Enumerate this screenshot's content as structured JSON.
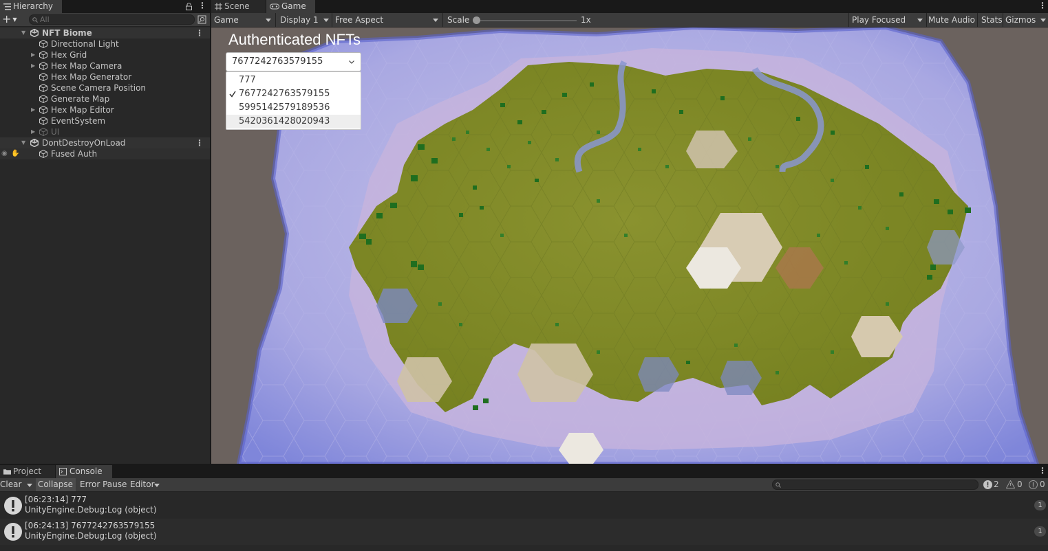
{
  "hierarchy": {
    "tab_label": "Hierarchy",
    "search_placeholder": "All",
    "items": [
      {
        "label": "NFT Biome",
        "type": "scene"
      },
      {
        "label": "Directional Light",
        "type": "object"
      },
      {
        "label": "Hex Grid",
        "type": "object",
        "expandable": true
      },
      {
        "label": "Hex Map Camera",
        "type": "object",
        "expandable": true
      },
      {
        "label": "Hex Map Generator",
        "type": "object"
      },
      {
        "label": "Scene Camera Position",
        "type": "object"
      },
      {
        "label": "Generate Map",
        "type": "object"
      },
      {
        "label": "Hex Map Editor",
        "type": "object",
        "expandable": true
      },
      {
        "label": "EventSystem",
        "type": "object"
      },
      {
        "label": "UI",
        "type": "object",
        "expandable": true,
        "disabled": true
      },
      {
        "label": "DontDestroyOnLoad",
        "type": "scene"
      },
      {
        "label": "Fused Auth",
        "type": "object"
      }
    ]
  },
  "game_view": {
    "tabs": [
      "Scene",
      "Game"
    ],
    "active_tab": "Game",
    "toolbar": {
      "mode": "Game",
      "display": "Display 1",
      "aspect": "Free Aspect",
      "scale_label": "Scale",
      "scale_value": "1x",
      "play_mode": "Play Focused",
      "mute_audio": "Mute Audio",
      "stats": "Stats",
      "gizmos": "Gizmos"
    },
    "ui": {
      "title": "Authenticated NFTs",
      "dropdown_selected": "7677242763579155",
      "options": [
        "777",
        "7677242763579155",
        "5995142579189536",
        "5420361428020943"
      ],
      "checked_index": 1,
      "hover_index": 3
    }
  },
  "console": {
    "tabs": [
      "Project",
      "Console"
    ],
    "active_tab": "Console",
    "toolbar": {
      "clear": "Clear",
      "collapse": "Collapse",
      "error_pause": "Error Pause",
      "editor": "Editor",
      "log_count": "2",
      "warning_count": "0",
      "error_count": "0"
    },
    "logs": [
      {
        "line1": "[06:23:14] 777",
        "line2": "UnityEngine.Debug:Log (object)",
        "count": "1"
      },
      {
        "line1": "[06:24:13] 7677242763579155",
        "line2": "UnityEngine.Debug:Log (object)",
        "count": "1"
      }
    ]
  },
  "colors": {
    "panel": "#282828",
    "toolbar": "#3c3c3c",
    "water": "#9ea6e0",
    "land": "#7f8a2a",
    "background": "#6b625e"
  }
}
